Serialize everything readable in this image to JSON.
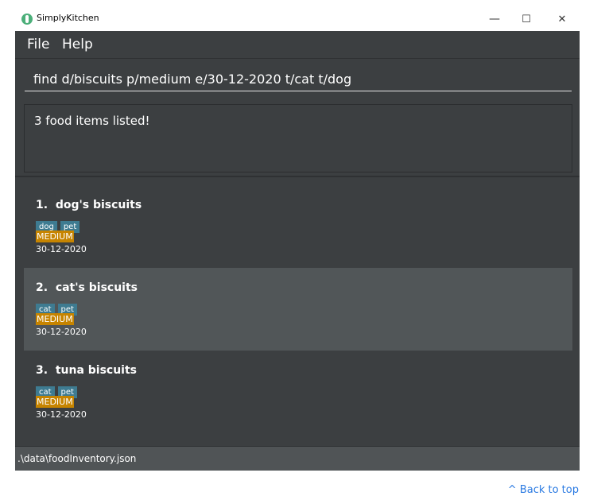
{
  "window": {
    "title": "SimplyKitchen",
    "controls": {
      "minimize": "—",
      "maximize": "☐",
      "close": "✕"
    }
  },
  "menu": {
    "items": [
      "File",
      "Help"
    ]
  },
  "command": {
    "value": "find d/biscuits p/medium e/30-12-2020 t/cat t/dog"
  },
  "result": {
    "message": "3 food items listed!"
  },
  "food_items": [
    {
      "index": "1.",
      "name": "dog's biscuits",
      "tags": [
        "dog",
        "pet"
      ],
      "priority": "MEDIUM",
      "expiry": "30-12-2020",
      "selected": false
    },
    {
      "index": "2.",
      "name": "cat's biscuits",
      "tags": [
        "cat",
        "pet"
      ],
      "priority": "MEDIUM",
      "expiry": "30-12-2020",
      "selected": true
    },
    {
      "index": "3.",
      "name": "tuna biscuits",
      "tags": [
        "cat",
        "pet"
      ],
      "priority": "MEDIUM",
      "expiry": "30-12-2020",
      "selected": false
    }
  ],
  "status": {
    "path": ".\\data\\foodInventory.json"
  },
  "page": {
    "back_to_top": "^ Back to top"
  },
  "colors": {
    "background": "#3c3f41",
    "selected": "#515658",
    "tag": "#3e7b91",
    "priority": "#c68400",
    "link": "#2a7ae2"
  }
}
